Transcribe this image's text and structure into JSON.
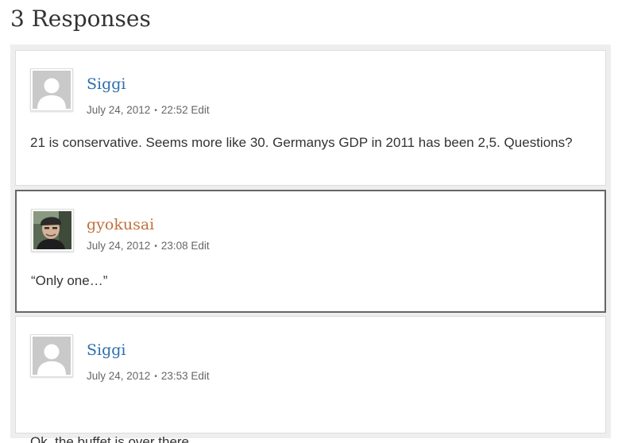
{
  "heading": "3 Responses",
  "comments": [
    {
      "author": "Siggi",
      "date": "July 24, 2012",
      "time": "22:52",
      "edit": "Edit",
      "text": "21 is conservative. Seems more like 30. Germanys GDP in 2011 has been 2,5. Questions?",
      "author_color": "#2a6ead",
      "avatar": "default-avatar-icon"
    },
    {
      "author": "gyokusai",
      "date": "July 24, 2012",
      "time": "23:08",
      "edit": "Edit",
      "text": "“Only one…”",
      "author_color": "#c0703c",
      "avatar": "user-photo"
    },
    {
      "author": "Siggi",
      "date": "July 24, 2012",
      "time": "23:53",
      "edit": "Edit",
      "text": "Ok, the buffet is over there.",
      "author_color": "#2a6ead",
      "avatar": "default-avatar-icon"
    }
  ],
  "meta_separator": "•"
}
